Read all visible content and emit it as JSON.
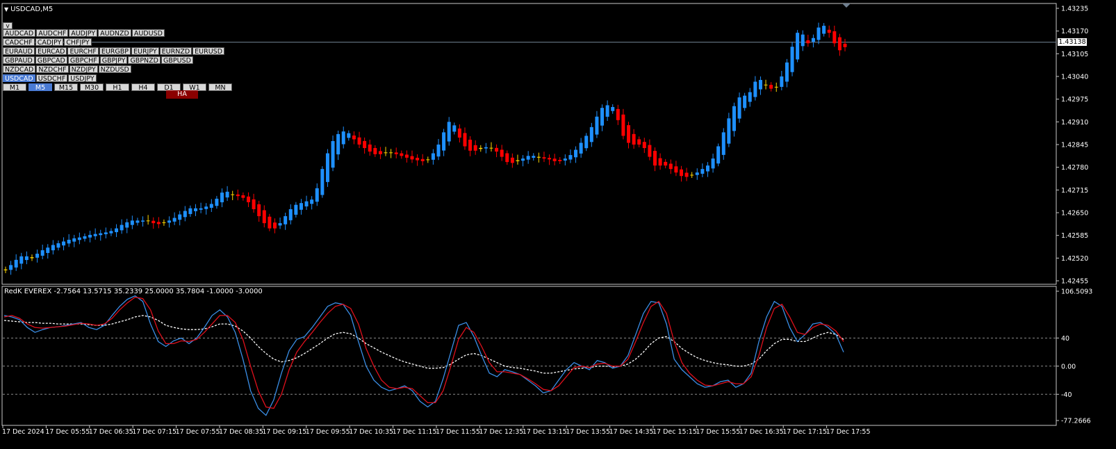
{
  "window_title": "USDCAD,M5",
  "indicator_title": "RedK EVEREX -2.7564 13.5715 35.2339 25.0000 35.7804 -1.0000 -3.0000",
  "current_price": "1.43138",
  "collapse_label": "v",
  "symbol_rows": [
    [
      "AUDCAD",
      "AUDCHF",
      "AUDJPY",
      "AUDNZD",
      "AUDUSD"
    ],
    [
      "CADCHF",
      "CADJPY",
      "CHFJPY"
    ],
    [
      "EURAUD",
      "EURCAD",
      "EURCHF",
      "EURGBP",
      "EURJPY",
      "EURNZD",
      "EURUSD"
    ],
    [
      "GBPAUD",
      "GBPCAD",
      "GBPCHF",
      "GBPJPY",
      "GBPNZD",
      "GBPUSD"
    ],
    [
      "NZDCAD",
      "NZDCHF",
      "NZDJPY",
      "NZDUSD"
    ],
    [
      "USDCAD",
      "USDCHF",
      "USDJPY"
    ]
  ],
  "active_symbol": "USDCAD",
  "timeframes": [
    "M1",
    "M5",
    "M15",
    "M30",
    "H1",
    "H4",
    "D1",
    "W1",
    "MN"
  ],
  "active_timeframe": "M5",
  "ha_label": "HA",
  "price_axis": [
    "1.43235",
    "1.43170",
    "1.43105",
    "1.43040",
    "1.42975",
    "1.42910",
    "1.42845",
    "1.42780",
    "1.42715",
    "1.42650",
    "1.42585",
    "1.42520",
    "1.42455"
  ],
  "indicator_axis": [
    "106.5093",
    "40",
    "0.00",
    "-40",
    "-77.2666"
  ],
  "time_axis": [
    "17 Dec 2024",
    "17 Dec 05:55",
    "17 Dec 06:35",
    "17 Dec 07:15",
    "17 Dec 07:55",
    "17 Dec 08:35",
    "17 Dec 09:15",
    "17 Dec 09:55",
    "17 Dec 10:35",
    "17 Dec 11:15",
    "17 Dec 11:55",
    "17 Dec 12:35",
    "17 Dec 13:15",
    "17 Dec 13:55",
    "17 Dec 14:35",
    "17 Dec 15:15",
    "17 Dec 15:55",
    "17 Dec 16:35",
    "17 Dec 17:15",
    "17 Dec 17:55"
  ],
  "colors": {
    "background": "#000000",
    "bull": "#1e90ff",
    "bear": "#ff0000",
    "doji": "#ffd700",
    "line_blue": "#3a8ee6",
    "line_red": "#e0101c",
    "line_white": "#ffffff",
    "price_line": "#778899"
  },
  "chart_data": {
    "type": "candlestick",
    "ylim": [
      1.42455,
      1.43235
    ],
    "current_price": 1.43138,
    "closes": [
      1.4249,
      1.4251,
      1.4252,
      1.4253,
      1.4252,
      1.42525,
      1.4254,
      1.42545,
      1.42555,
      1.4256,
      1.42565,
      1.4257,
      1.42575,
      1.42578,
      1.4258,
      1.42585,
      1.42588,
      1.4259,
      1.42592,
      1.42595,
      1.426,
      1.4261,
      1.4262,
      1.42625,
      1.4263,
      1.42625,
      1.4263,
      1.42625,
      1.42615,
      1.4262,
      1.42625,
      1.4263,
      1.4264,
      1.4265,
      1.4266,
      1.42665,
      1.4266,
      1.42665,
      1.4267,
      1.4268,
      1.427,
      1.42715,
      1.42705,
      1.427,
      1.42695,
      1.4269,
      1.4267,
      1.4265,
      1.4263,
      1.4261,
      1.426,
      1.4261,
      1.4263,
      1.4265,
      1.4267,
      1.42675,
      1.4268,
      1.42685,
      1.4269,
      1.4275,
      1.428,
      1.4284,
      1.4287,
      1.4288,
      1.42885,
      1.4287,
      1.4285,
      1.4284,
      1.4283,
      1.4282,
      1.42815,
      1.4282,
      1.42825,
      1.4282,
      1.42815,
      1.4281,
      1.42805,
      1.428,
      1.428,
      1.42795,
      1.4281,
      1.4283,
      1.4286,
      1.429,
      1.4292,
      1.4288,
      1.4285,
      1.4283,
      1.42825,
      1.4283,
      1.42835,
      1.4284,
      1.4283,
      1.4282,
      1.428,
      1.4279,
      1.42795,
      1.428,
      1.4281,
      1.42815,
      1.4281,
      1.42805,
      1.42805,
      1.428,
      1.42795,
      1.428,
      1.4281,
      1.4282,
      1.4284,
      1.4286,
      1.4288,
      1.4291,
      1.4294,
      1.4296,
      1.42955,
      1.4295,
      1.4288,
      1.4286,
      1.4284,
      1.4285,
      1.4284,
      1.4283,
      1.4279,
      1.4278,
      1.4279,
      1.4278,
      1.4277,
      1.4276,
      1.4275,
      1.42755,
      1.4276,
      1.4277,
      1.4278,
      1.4279,
      1.4282,
      1.4286,
      1.429,
      1.4294,
      1.4297,
      1.4299,
      1.4298,
      1.4301,
      1.4304,
      1.4302,
      1.4301,
      1.43,
      1.4302,
      1.4306,
      1.431,
      1.4315,
      1.4318,
      1.4314,
      1.4313,
      1.4317,
      1.4319,
      1.4318,
      1.4315,
      1.4312,
      1.4311,
      1.43138
    ],
    "ha_colors": "bull: rising, bear: falling",
    "indicator": {
      "name": "RedK EVEREX",
      "ylim": [
        -77.2666,
        106.5093
      ],
      "levels": [
        40,
        0,
        -40
      ],
      "blue": [
        72,
        70,
        66,
        55,
        48,
        52,
        55,
        56,
        58,
        60,
        62,
        55,
        52,
        58,
        72,
        85,
        95,
        100,
        92,
        60,
        35,
        28,
        36,
        40,
        32,
        40,
        55,
        72,
        80,
        70,
        48,
        10,
        -35,
        -60,
        -70,
        -48,
        -10,
        22,
        38,
        42,
        55,
        70,
        85,
        90,
        88,
        72,
        35,
        0,
        -20,
        -30,
        -35,
        -32,
        -28,
        -35,
        -50,
        -58,
        -50,
        -18,
        20,
        58,
        62,
        42,
        15,
        -10,
        -15,
        -5,
        -8,
        -12,
        -20,
        -28,
        -38,
        -35,
        -20,
        -5,
        5,
        0,
        -5,
        8,
        5,
        -3,
        0,
        15,
        45,
        75,
        92,
        90,
        60,
        10,
        -5,
        -15,
        -25,
        -30,
        -28,
        -22,
        -20,
        -30,
        -25,
        -10,
        35,
        70,
        92,
        85,
        55,
        35,
        45,
        60,
        62,
        55,
        45,
        20
      ],
      "red": [
        70,
        72,
        68,
        60,
        55,
        54,
        55,
        56,
        57,
        59,
        61,
        60,
        58,
        60,
        68,
        80,
        90,
        98,
        96,
        80,
        50,
        32,
        32,
        36,
        35,
        38,
        48,
        60,
        72,
        72,
        62,
        38,
        0,
        -35,
        -58,
        -60,
        -40,
        -5,
        20,
        35,
        48,
        62,
        75,
        85,
        88,
        82,
        60,
        25,
        0,
        -20,
        -30,
        -32,
        -30,
        -32,
        -42,
        -52,
        -52,
        -35,
        0,
        38,
        55,
        48,
        28,
        5,
        -8,
        -8,
        -10,
        -12,
        -18,
        -25,
        -33,
        -35,
        -28,
        -15,
        -2,
        0,
        -2,
        3,
        4,
        0,
        0,
        10,
        35,
        62,
        85,
        92,
        75,
        35,
        5,
        -10,
        -20,
        -27,
        -28,
        -25,
        -22,
        -25,
        -25,
        -15,
        15,
        55,
        82,
        88,
        70,
        48,
        45,
        55,
        60,
        58,
        50,
        35
      ],
      "white": [
        65,
        64,
        63,
        62,
        62,
        61,
        61,
        60,
        60,
        60,
        60,
        59,
        58,
        58,
        60,
        63,
        66,
        70,
        72,
        70,
        65,
        58,
        55,
        53,
        52,
        52,
        53,
        56,
        60,
        60,
        57,
        50,
        40,
        28,
        18,
        10,
        6,
        8,
        12,
        18,
        25,
        32,
        40,
        46,
        48,
        46,
        40,
        32,
        26,
        20,
        15,
        10,
        6,
        3,
        0,
        -3,
        -3,
        -2,
        3,
        10,
        16,
        18,
        15,
        10,
        5,
        0,
        -2,
        -3,
        -5,
        -7,
        -10,
        -10,
        -8,
        -6,
        -4,
        -3,
        -2,
        0,
        0,
        -1,
        0,
        3,
        10,
        20,
        32,
        40,
        42,
        35,
        25,
        18,
        12,
        8,
        5,
        3,
        2,
        0,
        0,
        3,
        10,
        22,
        32,
        38,
        38,
        35,
        35,
        40,
        45,
        48,
        45,
        38
      ]
    }
  }
}
